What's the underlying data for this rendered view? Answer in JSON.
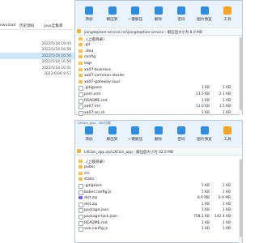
{
  "background_explorer": {
    "path": [
      "ownload",
      "历史源码",
      "java全集库"
    ],
    "timestamps": [
      "2022/5/18 19:44",
      "2022/5/18 16:56",
      "2022/5/18 16:56",
      "2022/5/18 16:56",
      "2022/5/18 16:41",
      "2022/6/06 8:57"
    ],
    "selected_index": 2
  },
  "window1": {
    "toolbar": [
      {
        "label": "添加",
        "color": "#2f8de0",
        "icon": "add-icon"
      },
      {
        "label": "解压到",
        "color": "#2f8de0",
        "icon": "extract-icon"
      },
      {
        "label": "一键解压",
        "color": "#2f8de0",
        "icon": "one-click-extract-icon"
      },
      {
        "label": "删除",
        "color": "#2f8de0",
        "icon": "delete-icon"
      },
      {
        "label": "密码",
        "color": "#2f8de0",
        "icon": "password-icon"
      },
      {
        "label": "图片预览",
        "color": "#2f8de0",
        "icon": "image-preview-icon"
      },
      {
        "label": "工具",
        "color": "#f0a42a",
        "icon": "tools-icon"
      }
    ],
    "address": "jiangdoption-service.rar\\jiangdoption-service - 解压后大小为 8.0 MB",
    "rows": [
      {
        "type": "up",
        "name": "..(上级目录)",
        "size": "",
        "packed": ""
      },
      {
        "type": "folder",
        "name": ".git",
        "size": "",
        "packed": ""
      },
      {
        "type": "folder",
        "name": ".idea",
        "size": "",
        "packed": ""
      },
      {
        "type": "folder",
        "name": "config",
        "size": "",
        "packed": ""
      },
      {
        "type": "folder",
        "name": "logs",
        "size": "",
        "packed": ""
      },
      {
        "type": "folder",
        "name": "xa07-business",
        "size": "",
        "packed": ""
      },
      {
        "type": "folder",
        "name": "xa07-common-starter",
        "size": "",
        "packed": ""
      },
      {
        "type": "folder",
        "name": "xa07-gateway-zuul",
        "size": "",
        "packed": ""
      },
      {
        "type": "file",
        "name": ".gitignore",
        "size": "1 KB",
        "packed": "1 KB"
      },
      {
        "type": "file",
        "name": "pom.xml",
        "size": "13.5 KB",
        "packed": "2.1 KB"
      },
      {
        "type": "file",
        "name": "README.md",
        "size": "1 KB",
        "packed": "1 KB"
      },
      {
        "type": "file",
        "name": "xa07.iml",
        "size": "11.0 KB",
        "packed": "1.5 KB"
      },
      {
        "type": "file",
        "name": "xa07-mi.sh",
        "size": "1 KB",
        "packed": "1 KB"
      }
    ]
  },
  "window2": {
    "title": "LXCoin_app - 360压缩",
    "toolbar": [
      {
        "label": "添加",
        "color": "#2f8de0",
        "icon": "add-icon"
      },
      {
        "label": "解压到",
        "color": "#2f8de0",
        "icon": "extract-icon"
      },
      {
        "label": "一键解压",
        "color": "#2f8de0",
        "icon": "one-click-extract-icon"
      },
      {
        "label": "删除",
        "color": "#2f8de0",
        "icon": "delete-icon"
      },
      {
        "label": "密码",
        "color": "#2f8de0",
        "icon": "password-icon"
      },
      {
        "label": "图片预览",
        "color": "#2f8de0",
        "icon": "image-preview-icon"
      },
      {
        "label": "工具",
        "color": "#f0a42a",
        "icon": "tools-icon"
      }
    ],
    "address": "LXCoin_app.zip\\LXCoin_app - 解压后大小为 32.5 MB",
    "rows": [
      {
        "type": "up",
        "name": "..(上级目录)",
        "size": "",
        "packed": ""
      },
      {
        "type": "folder",
        "name": "public",
        "size": "",
        "packed": ""
      },
      {
        "type": "folder",
        "name": "src",
        "size": "",
        "packed": ""
      },
      {
        "type": "folder",
        "name": "static",
        "size": "",
        "packed": ""
      },
      {
        "type": "file",
        "name": ".gitignore",
        "size": "1 KB",
        "packed": "1 KB"
      },
      {
        "type": "file",
        "name": "babel.config.js",
        "size": "1 KB",
        "packed": "1 KB"
      },
      {
        "type": "zip",
        "name": "dist.zip",
        "size": "8.9 MB",
        "packed": "8.9 MB"
      },
      {
        "type": "file",
        "name": "dist.zip",
        "size": "1 KB",
        "packed": "1 KB"
      },
      {
        "type": "file",
        "name": "package.json",
        "size": "1 KB",
        "packed": "1 KB"
      },
      {
        "type": "file",
        "name": "package-lock.json",
        "size": "758.1 KB",
        "packed": "142.4 KB"
      },
      {
        "type": "file",
        "name": "README.md",
        "size": "1 KB",
        "packed": "1 KB"
      },
      {
        "type": "file",
        "name": "vue.config.js",
        "size": "1 KB",
        "packed": "1 KB"
      }
    ]
  }
}
